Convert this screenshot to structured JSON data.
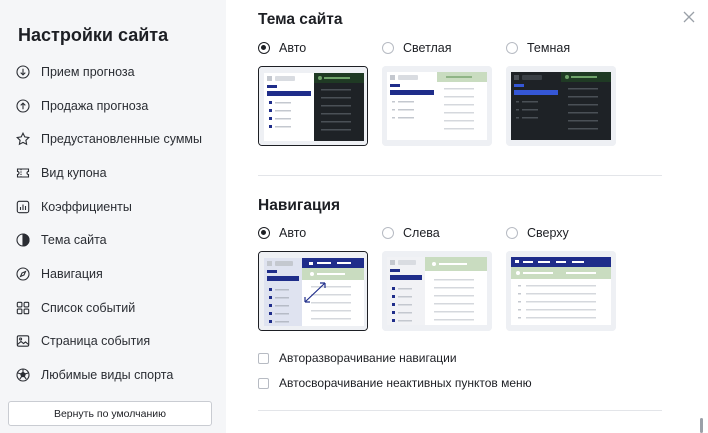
{
  "sidebar": {
    "title": "Настройки сайта",
    "items": [
      {
        "label": "Прием прогноза",
        "icon": "arrow-down-circle-icon"
      },
      {
        "label": "Продажа прогноза",
        "icon": "arrow-up-circle-icon"
      },
      {
        "label": "Предустановленные суммы",
        "icon": "star-icon"
      },
      {
        "label": "Вид купона",
        "icon": "ticket-icon"
      },
      {
        "label": "Коэффициенты",
        "icon": "bar-chart-icon"
      },
      {
        "label": "Тема сайта",
        "icon": "half-circle-icon"
      },
      {
        "label": "Навигация",
        "icon": "compass-icon"
      },
      {
        "label": "Список событий",
        "icon": "grid-icon"
      },
      {
        "label": "Страница события",
        "icon": "image-icon"
      },
      {
        "label": "Любимые виды спорта",
        "icon": "ball-icon"
      }
    ],
    "reset_label": "Вернуть по умолчанию"
  },
  "theme": {
    "title": "Тема сайта",
    "options": [
      {
        "label": "Авто",
        "selected": true
      },
      {
        "label": "Светлая",
        "selected": false
      },
      {
        "label": "Темная",
        "selected": false
      }
    ]
  },
  "navigation": {
    "title": "Навигация",
    "options": [
      {
        "label": "Авто",
        "selected": true
      },
      {
        "label": "Слева",
        "selected": false
      },
      {
        "label": "Сверху",
        "selected": false
      }
    ],
    "checkboxes": [
      {
        "label": "Авторазворачивание навигации",
        "checked": false
      },
      {
        "label": "Автосворачивание неактивных пунктов меню",
        "checked": false
      }
    ]
  },
  "colors": {
    "accent": "#1f2d8a",
    "green": "#c9dcc0",
    "dark": "#1e2226",
    "dark_green": "#1f3a24"
  }
}
